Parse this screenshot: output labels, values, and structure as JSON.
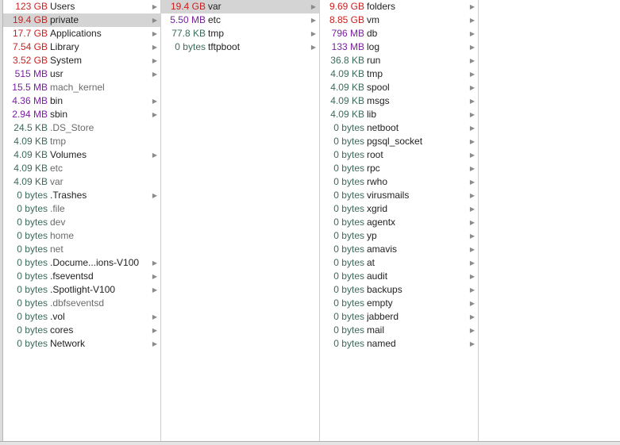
{
  "colors": {
    "gb": "#cc1f1f",
    "mb": "#7a1fa0",
    "kb": "#3c6a5c",
    "bytes": "#3c6a5c",
    "selection": "#d4d4d4"
  },
  "columns": [
    {
      "items": [
        {
          "size": "123 GB",
          "name": "Users",
          "folder": true,
          "unit": "gb"
        },
        {
          "size": "19.4 GB",
          "name": "private",
          "folder": true,
          "unit": "gb",
          "selected": true
        },
        {
          "size": "17.7 GB",
          "name": "Applications",
          "folder": true,
          "unit": "gb"
        },
        {
          "size": "7.54 GB",
          "name": "Library",
          "folder": true,
          "unit": "gb"
        },
        {
          "size": "3.52 GB",
          "name": "System",
          "folder": true,
          "unit": "gb"
        },
        {
          "size": "515 MB",
          "name": "usr",
          "folder": true,
          "unit": "mb"
        },
        {
          "size": "15.5 MB",
          "name": "mach_kernel",
          "folder": false,
          "unit": "mb"
        },
        {
          "size": "4.36 MB",
          "name": "bin",
          "folder": true,
          "unit": "mb"
        },
        {
          "size": "2.94 MB",
          "name": "sbin",
          "folder": true,
          "unit": "mb"
        },
        {
          "size": "24.5 KB",
          "name": ".DS_Store",
          "folder": false,
          "unit": "kb"
        },
        {
          "size": "4.09 KB",
          "name": "tmp",
          "folder": false,
          "unit": "kb"
        },
        {
          "size": "4.09 KB",
          "name": "Volumes",
          "folder": true,
          "unit": "kb"
        },
        {
          "size": "4.09 KB",
          "name": "etc",
          "folder": false,
          "unit": "kb"
        },
        {
          "size": "4.09 KB",
          "name": "var",
          "folder": false,
          "unit": "kb"
        },
        {
          "size": "0 bytes",
          "name": ".Trashes",
          "folder": true,
          "unit": "bytes"
        },
        {
          "size": "0 bytes",
          "name": ".file",
          "folder": false,
          "unit": "bytes"
        },
        {
          "size": "0 bytes",
          "name": "dev",
          "folder": false,
          "unit": "bytes"
        },
        {
          "size": "0 bytes",
          "name": "home",
          "folder": false,
          "unit": "bytes"
        },
        {
          "size": "0 bytes",
          "name": "net",
          "folder": false,
          "unit": "bytes"
        },
        {
          "size": "0 bytes",
          "name": ".Docume...ions-V100",
          "folder": true,
          "unit": "bytes"
        },
        {
          "size": "0 bytes",
          "name": ".fseventsd",
          "folder": true,
          "unit": "bytes"
        },
        {
          "size": "0 bytes",
          "name": ".Spotlight-V100",
          "folder": true,
          "unit": "bytes"
        },
        {
          "size": "0 bytes",
          "name": ".dbfseventsd",
          "folder": false,
          "unit": "bytes"
        },
        {
          "size": "0 bytes",
          "name": ".vol",
          "folder": true,
          "unit": "bytes"
        },
        {
          "size": "0 bytes",
          "name": "cores",
          "folder": true,
          "unit": "bytes"
        },
        {
          "size": "0 bytes",
          "name": "Network",
          "folder": true,
          "unit": "bytes"
        }
      ]
    },
    {
      "items": [
        {
          "size": "19.4 GB",
          "name": "var",
          "folder": true,
          "unit": "gb",
          "selected": true
        },
        {
          "size": "5.50 MB",
          "name": "etc",
          "folder": true,
          "unit": "mb"
        },
        {
          "size": "77.8 KB",
          "name": "tmp",
          "folder": true,
          "unit": "kb"
        },
        {
          "size": "0 bytes",
          "name": "tftpboot",
          "folder": true,
          "unit": "bytes"
        }
      ]
    },
    {
      "items": [
        {
          "size": "9.69 GB",
          "name": "folders",
          "folder": true,
          "unit": "gb"
        },
        {
          "size": "8.85 GB",
          "name": "vm",
          "folder": true,
          "unit": "gb"
        },
        {
          "size": "796 MB",
          "name": "db",
          "folder": true,
          "unit": "mb"
        },
        {
          "size": "133 MB",
          "name": "log",
          "folder": true,
          "unit": "mb"
        },
        {
          "size": "36.8 KB",
          "name": "run",
          "folder": true,
          "unit": "kb"
        },
        {
          "size": "4.09 KB",
          "name": "tmp",
          "folder": true,
          "unit": "kb"
        },
        {
          "size": "4.09 KB",
          "name": "spool",
          "folder": true,
          "unit": "kb"
        },
        {
          "size": "4.09 KB",
          "name": "msgs",
          "folder": true,
          "unit": "kb"
        },
        {
          "size": "4.09 KB",
          "name": "lib",
          "folder": true,
          "unit": "kb"
        },
        {
          "size": "0 bytes",
          "name": "netboot",
          "folder": true,
          "unit": "bytes"
        },
        {
          "size": "0 bytes",
          "name": "pgsql_socket",
          "folder": true,
          "unit": "bytes"
        },
        {
          "size": "0 bytes",
          "name": "root",
          "folder": true,
          "unit": "bytes"
        },
        {
          "size": "0 bytes",
          "name": "rpc",
          "folder": true,
          "unit": "bytes"
        },
        {
          "size": "0 bytes",
          "name": "rwho",
          "folder": true,
          "unit": "bytes"
        },
        {
          "size": "0 bytes",
          "name": "virusmails",
          "folder": true,
          "unit": "bytes"
        },
        {
          "size": "0 bytes",
          "name": "xgrid",
          "folder": true,
          "unit": "bytes"
        },
        {
          "size": "0 bytes",
          "name": "agentx",
          "folder": true,
          "unit": "bytes"
        },
        {
          "size": "0 bytes",
          "name": "yp",
          "folder": true,
          "unit": "bytes"
        },
        {
          "size": "0 bytes",
          "name": "amavis",
          "folder": true,
          "unit": "bytes"
        },
        {
          "size": "0 bytes",
          "name": "at",
          "folder": true,
          "unit": "bytes"
        },
        {
          "size": "0 bytes",
          "name": "audit",
          "folder": true,
          "unit": "bytes"
        },
        {
          "size": "0 bytes",
          "name": "backups",
          "folder": true,
          "unit": "bytes"
        },
        {
          "size": "0 bytes",
          "name": "empty",
          "folder": true,
          "unit": "bytes"
        },
        {
          "size": "0 bytes",
          "name": "jabberd",
          "folder": true,
          "unit": "bytes"
        },
        {
          "size": "0 bytes",
          "name": "mail",
          "folder": true,
          "unit": "bytes"
        },
        {
          "size": "0 bytes",
          "name": "named",
          "folder": true,
          "unit": "bytes"
        }
      ]
    },
    {
      "items": []
    }
  ],
  "icons": {
    "disclosure": "chevron-right-icon"
  }
}
